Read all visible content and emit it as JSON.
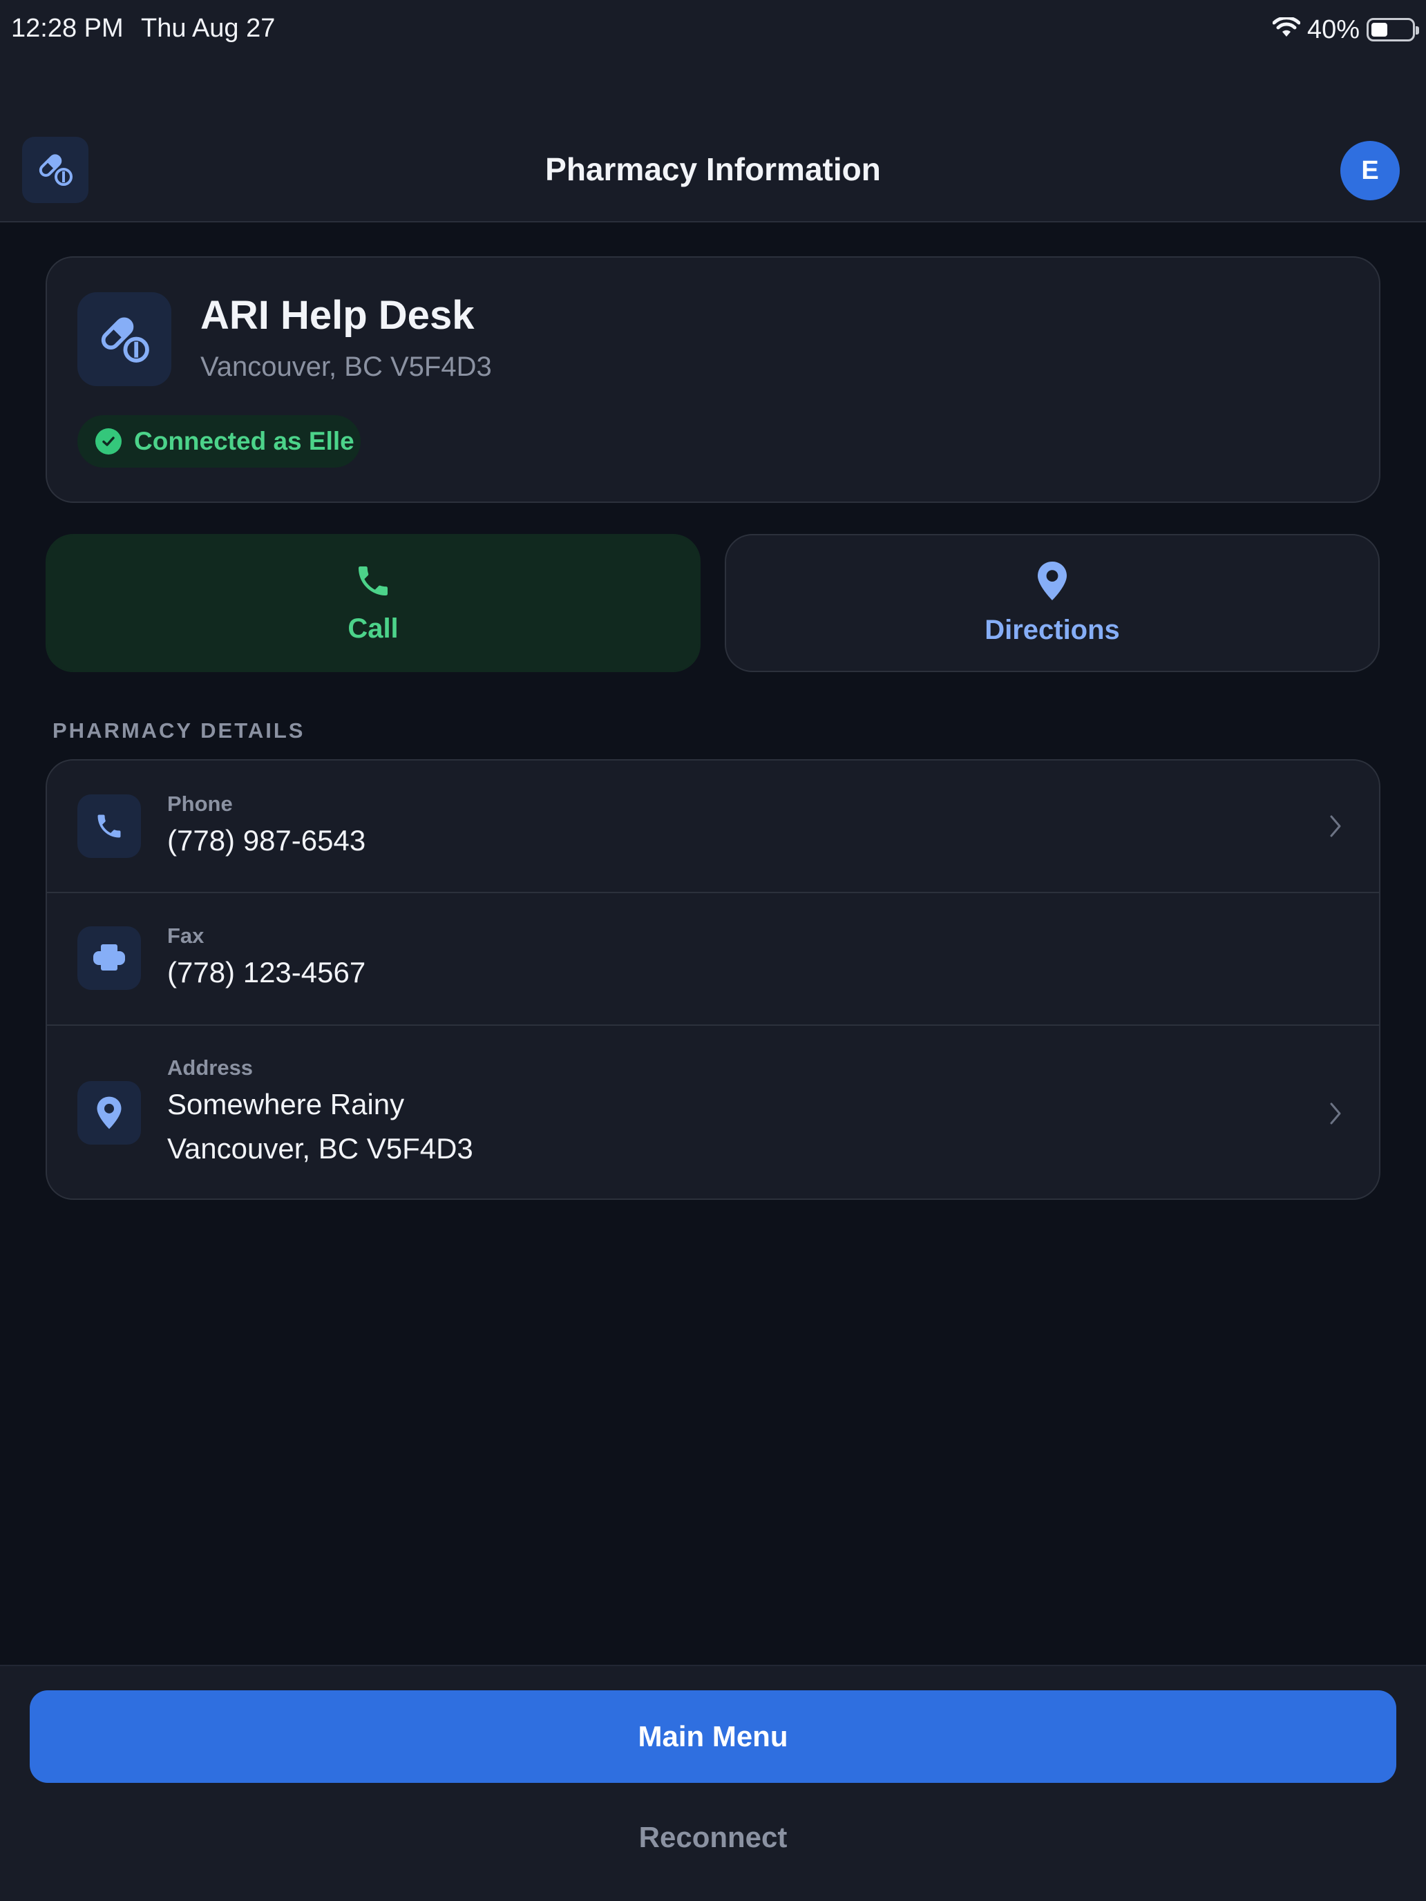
{
  "status_bar": {
    "time": "12:28 PM",
    "date": "Thu Aug 27",
    "battery": "40%",
    "battery_level": 0.4
  },
  "nav": {
    "title": "Pharmacy Information",
    "avatar_initial": "E"
  },
  "pharmacy": {
    "name": "ARI Help Desk",
    "location": "Vancouver, BC V5F4D3",
    "connection_status": "Connected as Elle"
  },
  "actions": {
    "call_label": "Call",
    "directions_label": "Directions"
  },
  "details": {
    "section_title": "PHARMACY DETAILS",
    "phone": {
      "label": "Phone",
      "value": "(778) 987-6543"
    },
    "fax": {
      "label": "Fax",
      "value": "(778) 123-4567"
    },
    "address": {
      "label": "Address",
      "line1": "Somewhere Rainy",
      "line2": "Vancouver, BC V5F4D3"
    }
  },
  "footer": {
    "main_menu_label": "Main Menu",
    "reconnect_label": "Reconnect"
  },
  "colors": {
    "accent_blue": "#2f6fe0",
    "success_green": "#4cd38a",
    "background": "#0d111a",
    "surface": "#181c27"
  },
  "icons": {
    "nav_left": "pills-icon",
    "call": "phone-icon",
    "directions": "map-pin-icon",
    "fax": "printer-icon",
    "chevron": "chevron-right-icon"
  }
}
